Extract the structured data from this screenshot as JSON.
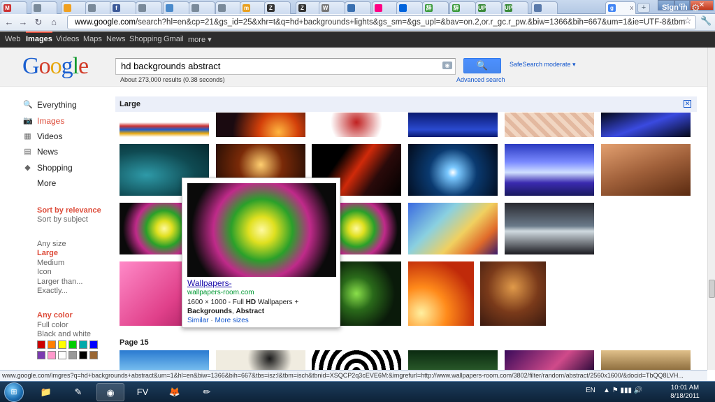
{
  "browser": {
    "tabs": [
      {
        "icon": "gmail-icon",
        "label": "M",
        "color": "#c33"
      },
      {
        "icon": "globe-icon",
        "label": "",
        "color": "#7a8a9a"
      },
      {
        "icon": "sun-icon",
        "label": "",
        "color": "#f0a020"
      },
      {
        "icon": "globe-icon",
        "label": "",
        "color": "#7a8a9a"
      },
      {
        "icon": "facebook-icon",
        "label": "f",
        "color": "#3b5998"
      },
      {
        "icon": "globe-icon",
        "label": "",
        "color": "#7a8a9a"
      },
      {
        "icon": "page-icon",
        "label": "",
        "color": "#4a8acb"
      },
      {
        "icon": "globe-icon",
        "label": "",
        "color": "#7a8a9a"
      },
      {
        "icon": "globe-icon",
        "label": "",
        "color": "#7a8a9a"
      },
      {
        "icon": "m-icon",
        "label": "m",
        "color": "#e8a020"
      },
      {
        "icon": "z-icon",
        "label": "Z",
        "color": "#333"
      },
      {
        "icon": "z-icon",
        "label": "Z",
        "color": "#333"
      },
      {
        "icon": "wordpress-icon",
        "label": "W",
        "color": "#777"
      },
      {
        "icon": "python-icon",
        "label": "",
        "color": "#3a70b0"
      },
      {
        "icon": "flickr-icon",
        "label": "",
        "color": "#ff0084"
      },
      {
        "icon": "flickr-icon",
        "label": "",
        "color": "#0063dc"
      },
      {
        "icon": "kanji-icon",
        "label": "辞",
        "color": "#3a9a3a"
      },
      {
        "icon": "kanji-icon",
        "label": "辞",
        "color": "#3a9a3a"
      },
      {
        "icon": "up-icon",
        "label": "UP",
        "color": "#3a8a3a"
      },
      {
        "icon": "up-icon",
        "label": "UP",
        "color": "#3a8a3a"
      },
      {
        "icon": "page-icon",
        "label": "",
        "color": "#5a7aaa"
      },
      {
        "icon": "google-icon",
        "label": "g",
        "color": "#4285f4",
        "active": true,
        "close": "x"
      }
    ],
    "newtab_label": "+",
    "url_host": "www.google.com",
    "url_rest": "/search?hl=en&cp=21&gs_id=25&xhr=t&q=hd+backgrounds+lights&gs_sm=&gs_upl=&bav=on.2,or.r_gc.r_pw.&biw=1366&bih=667&um=1&ie=UTF-8&tbm",
    "status_url": "www.google.com/imgres?q=hd+backgrounds+abstract&um=1&hl=en&biw=1366&bih=667&tbs=isz:l&tbm=isch&tbnid=XSQCP2q3cEVE6M:&imgrefurl=http://www.wallpapers-room.com/3802/filter/random/abstract/2560x1600/&docid=TbQQ8LVH..."
  },
  "gbar": {
    "links": [
      "Web",
      "Images",
      "Videos",
      "Maps",
      "News",
      "Shopping",
      "Gmail",
      "more ▾"
    ],
    "active": "Images",
    "signin": "Sign in"
  },
  "header": {
    "logo": [
      "G",
      "o",
      "o",
      "g",
      "l",
      "e"
    ],
    "logo_colors": [
      "#1a5fd0",
      "#d23c29",
      "#e7a80f",
      "#1a5fd0",
      "#139a2f",
      "#d23c29"
    ],
    "query": "hd backgrounds abstract",
    "safesearch": "SafeSearch moderate ▾",
    "result_stats": "About 273,000 results (0.38 seconds)",
    "advanced_search": "Advanced search"
  },
  "leftnav": {
    "items": [
      {
        "label": "Everything",
        "icon": "search-icon",
        "glyph": "🔍",
        "selected": false
      },
      {
        "label": "Images",
        "icon": "camera-icon",
        "glyph": "📷",
        "selected": true
      },
      {
        "label": "Videos",
        "icon": "film-icon",
        "glyph": "▦",
        "selected": false
      },
      {
        "label": "News",
        "icon": "newspaper-icon",
        "glyph": "▤",
        "selected": false
      },
      {
        "label": "Shopping",
        "icon": "tag-icon",
        "glyph": "◆",
        "selected": false
      },
      {
        "label": "More",
        "icon": "",
        "glyph": "",
        "selected": false
      }
    ],
    "sort": [
      {
        "label": "Sort by relevance",
        "selected": true
      },
      {
        "label": "Sort by subject",
        "selected": false
      }
    ],
    "size": [
      {
        "label": "Any size",
        "selected": false
      },
      {
        "label": "Large",
        "selected": true
      },
      {
        "label": "Medium",
        "selected": false
      },
      {
        "label": "Icon",
        "selected": false
      },
      {
        "label": "Larger than...",
        "selected": false
      },
      {
        "label": "Exactly...",
        "selected": false
      }
    ],
    "color": [
      {
        "label": "Any color",
        "selected": true
      },
      {
        "label": "Full color",
        "selected": false
      },
      {
        "label": "Black and white",
        "selected": false
      }
    ],
    "swatches": [
      "#cc0000",
      "#ff7f00",
      "#ffff00",
      "#00cc00",
      "#00aaaa",
      "#0000ff",
      "#7a3ab0",
      "#ff99cc",
      "#ffffff",
      "#999999",
      "#000000",
      "#996633"
    ]
  },
  "results": {
    "section_label": "Large",
    "close_label": "✕",
    "page_label": "Page 15",
    "thumbs": [
      {
        "row": 0,
        "bg": "linear-gradient(#fff 0%,#fff 40%,#c33 55%,#1a5fd0 70%,#e7a80f 85%,#fff 100%)"
      },
      {
        "row": 0,
        "bg": "radial-gradient(circle at 70% 80%,#ffb640,#d3400a 30%,#1a0a10 70%)"
      },
      {
        "row": 0,
        "bg": "radial-gradient(circle at 50% 40%,#c02020,#ffffff 55%)"
      },
      {
        "row": 0,
        "bg": "linear-gradient(#0a1a70,#2a4ad0 70%,#0a1a70)"
      },
      {
        "row": 0,
        "bg": "repeating-linear-gradient(45deg,#f1d6c2,#f1d6c2 6px,#e3b9a0 6px,#e3b9a0 12px)"
      },
      {
        "row": 0,
        "bg": "linear-gradient(160deg,#040818,#3a4ae0 50%,#040818)"
      },
      {
        "row": 1,
        "bg": "radial-gradient(ellipse at 30% 60%,#2e9aa8,#0f4a52 55%,#062a30)"
      },
      {
        "row": 1,
        "bg": "radial-gradient(circle at 50% 40%,#ffcf70,#7a2a08 40%,#1a0a04)"
      },
      {
        "row": 1,
        "bg": "linear-gradient(125deg,#000 30%,#d02a0a 50%,#2a0a0a 70%,#000)"
      },
      {
        "row": 1,
        "bg": "radial-gradient(circle at 50% 55%,#ffffff,#7ac8ff 10%,#0a3a70 45%,#020a1a)"
      },
      {
        "row": 1,
        "bg": "linear-gradient(#2a3ac0,#7a8aff 35%,#d0e0ff 55%,#3a2ab0 75%,#1a1a60)"
      },
      {
        "row": 1,
        "bg": "linear-gradient(160deg,#e3a070,#a0603a 50%,#5a2a10)"
      },
      {
        "row": 2,
        "bg": "radial-gradient(circle,#fff9a0,#e0e020 15%,#2aa02a 35%,#c02a8a 55%,#0a0a0a 80%)"
      },
      {
        "row": 2,
        "bg": "radial-gradient(circle at 60% 50%,#d0e8ff,#5a8ad0 45%,#0a2a60)"
      },
      {
        "row": 2,
        "bg": "radial-gradient(circle,#fff9a0,#e0e020 15%,#2aa02a 35%,#c02a8a 55%,#0a0a0a 80%)"
      },
      {
        "row": 2,
        "bg": "linear-gradient(135deg,#3a6ae0,#8ad0e0 35%,#f0d060 60%,#e06a2a 80%,#3a1a6a)"
      },
      {
        "row": 2,
        "bg": "linear-gradient(#2a2a30,#6a7a8a 45%,#d0dae0 55%,#1a1a20)"
      },
      {
        "row": 3,
        "bg": "linear-gradient(135deg,#ff8ac8,#e0408a 60%,#a01a5a)"
      },
      {
        "row": 3,
        "bg": "radial-gradient(circle at 50% 50%,#ff60c0,#7a2a8a 35%,#1a0a20 75%)"
      },
      {
        "row": 3,
        "bg": "radial-gradient(circle at 50% 50%,#8ae04a,#2a6a1a 30%,#0a1a0a 70%)"
      },
      {
        "row": 3,
        "bg": "radial-gradient(circle at 20% 80%,#fff0a0,#ff8a1a 35%,#c02a0a 75%)"
      },
      {
        "row": 3,
        "bg": "radial-gradient(circle at 50% 40%,#e09a4a,#7a3a1a 50%,#3a1a10)"
      },
      {
        "row": 4,
        "bg": "linear-gradient(#2a7ad0,#7ac0f0)"
      },
      {
        "row": 4,
        "bg": "radial-gradient(circle at 60% 40%,#1a1a1a,#f0ece0 40%)"
      },
      {
        "row": 4,
        "bg": "repeating-radial-gradient(circle at 50% 100%,#000,#000 6px,#fff 6px,#fff 12px)"
      },
      {
        "row": 4,
        "bg": "linear-gradient(#0a2a10,#2a5a2a)"
      },
      {
        "row": 4,
        "bg": "linear-gradient(135deg,#3a0a5a,#d04a8a 60%,#2a0a3a)"
      },
      {
        "row": 4,
        "bg": "linear-gradient(#e0c08a,#8a6a3a)"
      }
    ]
  },
  "hovercard": {
    "title": "Wallpapers-",
    "url": "wallpapers-room.com",
    "dims": "1600 × 1000",
    "desc_a": " - Full ",
    "desc_hd": "HD",
    "desc_b": " Wallpapers + ",
    "desc_bg": "Backgrounds",
    "desc_sep": ", ",
    "desc_abs": "Abstract",
    "similar": "Similar",
    "dot": " · ",
    "more_sizes": "More sizes"
  },
  "taskbar": {
    "start": "⊞",
    "apps": [
      {
        "name": "explorer-taskbar-button",
        "glyph": "📁",
        "open": false
      },
      {
        "name": "notepad-taskbar-button",
        "glyph": "✎",
        "open": false
      },
      {
        "name": "chrome-taskbar-button",
        "glyph": "◉",
        "open": true
      },
      {
        "name": "fv-taskbar-button",
        "glyph": "FV",
        "open": false
      },
      {
        "name": "gimp-taskbar-button",
        "glyph": "🦊",
        "open": false
      },
      {
        "name": "pencil-taskbar-button",
        "glyph": "✏",
        "open": false
      }
    ],
    "language": "EN",
    "tray_icons": "▲ ⚑ ▮▮▮ 🔊",
    "time": "10:01 AM",
    "date": "8/18/2011"
  }
}
